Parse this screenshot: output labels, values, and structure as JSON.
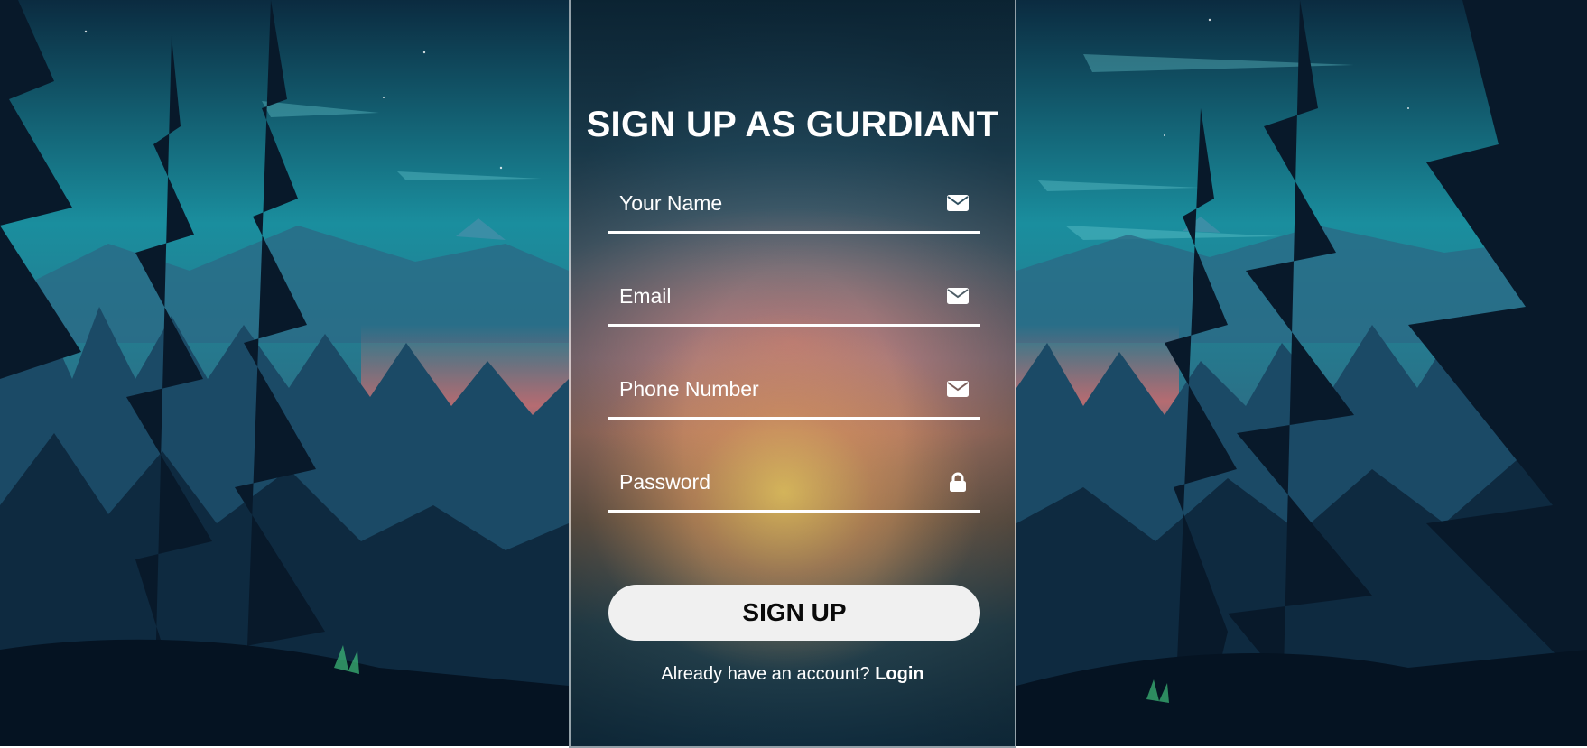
{
  "form": {
    "title": "SIGN UP AS GURDIANT",
    "fields": [
      {
        "placeholder": "Your Name",
        "icon": "envelope-icon",
        "type": "text"
      },
      {
        "placeholder": "Email",
        "icon": "envelope-icon",
        "type": "email"
      },
      {
        "placeholder": "Phone Number",
        "icon": "envelope-icon",
        "type": "tel"
      },
      {
        "placeholder": "Password",
        "icon": "lock-icon",
        "type": "password"
      }
    ],
    "submit_label": "SIGN UP",
    "login_prompt": "Already have an account?",
    "login_link": "Login"
  },
  "colors": {
    "text": "#ffffff",
    "button_bg": "#f0f0f0",
    "button_text": "#0a0a0a",
    "underline": "#ffffff"
  }
}
